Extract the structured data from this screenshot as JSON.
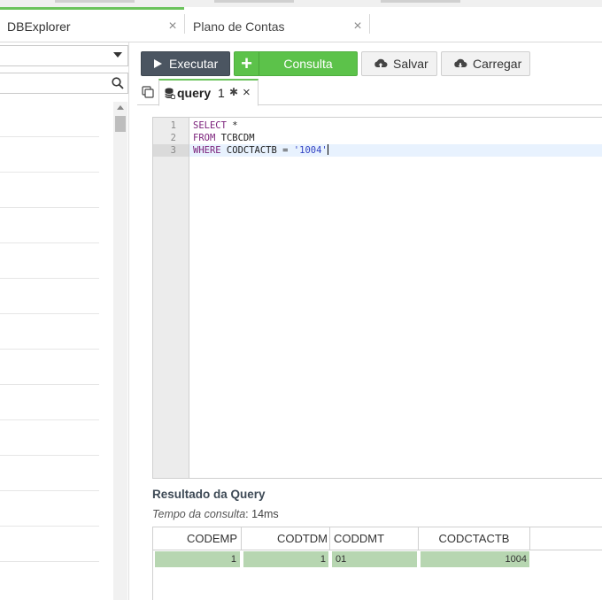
{
  "tabs": [
    {
      "label": "DBExplorer",
      "close": "×"
    },
    {
      "label": "Plano de Contas",
      "close": "×"
    }
  ],
  "toolbar": {
    "execute_label": "Executar",
    "query_label": "Consulta",
    "query_plus": "+",
    "save_label": "Salvar",
    "load_label": "Carregar"
  },
  "query_tab": {
    "label": "query",
    "number": "1",
    "modified_mark": "✱",
    "close": "×"
  },
  "editor": {
    "line_numbers": [
      "1",
      "2",
      "3"
    ],
    "lines": [
      {
        "kw": "SELECT",
        "rest": " *"
      },
      {
        "kw": "FROM",
        "rest": " TCBCDM"
      },
      {
        "kw": "WHERE",
        "rest": " CODCTACTB = ",
        "str": "'1004'"
      }
    ]
  },
  "results": {
    "title": "Resultado da Query",
    "time_label": "Tempo da consulta",
    "time_value": ": 14ms",
    "columns": [
      "CODEMP",
      "CODTDM",
      "CODDMT",
      "CODCTACTB"
    ],
    "rows": [
      [
        "1",
        "1",
        "01",
        "1004"
      ]
    ]
  },
  "colors": {
    "accent_green": "#5cc24a",
    "dark_button": "#4b5561",
    "cell_highlight": "#b7d6b1"
  }
}
